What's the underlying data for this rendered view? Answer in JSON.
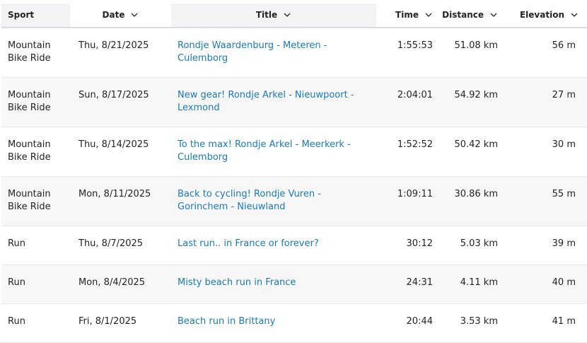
{
  "headers": {
    "sport": "Sport",
    "date": "Date",
    "title": "Title",
    "time": "Time",
    "distance": "Distance",
    "elevation": "Elevation"
  },
  "rows": [
    {
      "sport": "Mountain Bike Ride",
      "date": "Thu, 8/21/2025",
      "title": "Rondje Waardenburg - Meteren - Culemborg",
      "time": "1:55:53",
      "distance": "51.08 km",
      "elevation": "56 m"
    },
    {
      "sport": "Mountain Bike Ride",
      "date": "Sun, 8/17/2025",
      "title": "New gear! Rondje Arkel - Nieuwpoort - Lexmond",
      "time": "2:04:01",
      "distance": "54.92 km",
      "elevation": "27 m"
    },
    {
      "sport": "Mountain Bike Ride",
      "date": "Thu, 8/14/2025",
      "title": "To the max! Rondje Arkel - Meerkerk - Culemborg",
      "time": "1:52:52",
      "distance": "50.42 km",
      "elevation": "30 m"
    },
    {
      "sport": "Mountain Bike Ride",
      "date": "Mon, 8/11/2025",
      "title": "Back to cycling! Rondje Vuren - Gorinchem - Nieuwland",
      "time": "1:09:11",
      "distance": "30.86 km",
      "elevation": "55 m"
    },
    {
      "sport": "Run",
      "date": "Thu, 8/7/2025",
      "title": "Last run.. in France or forever?",
      "time": "30:12",
      "distance": "5.03 km",
      "elevation": "39 m"
    },
    {
      "sport": "Run",
      "date": "Mon, 8/4/2025",
      "title": "Misty beach run in France",
      "time": "24:31",
      "distance": "4.11 km",
      "elevation": "40 m"
    },
    {
      "sport": "Run",
      "date": "Fri, 8/1/2025",
      "title": "Beach run in Brittany",
      "time": "20:44",
      "distance": "3.53 km",
      "elevation": "41 m"
    }
  ],
  "colors": {
    "link": "#1a7bb8",
    "header_bg": "#f3f3f5",
    "alt_row_bg": "#f7f7f8"
  },
  "icons": {
    "sort": "chevron-down-icon"
  }
}
